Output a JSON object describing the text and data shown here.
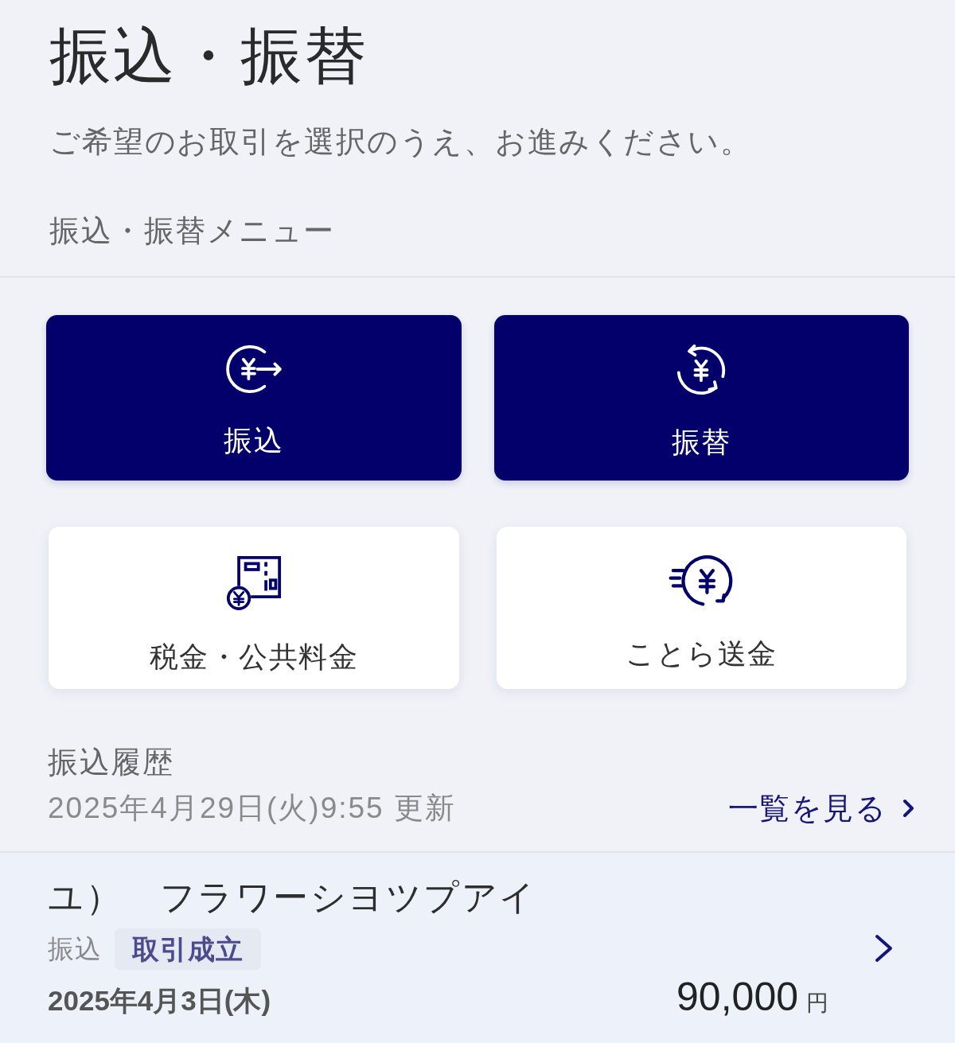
{
  "title": "振込・振替",
  "subtitle": "ご希望のお取引を選択のうえ、お進みください。",
  "menu": {
    "heading": "振込・振替メニュー",
    "items": [
      {
        "label": "振込",
        "kind": "primary"
      },
      {
        "label": "振替",
        "kind": "primary"
      },
      {
        "label": "税金・公共料金",
        "kind": "secondary"
      },
      {
        "label": "ことら送金",
        "kind": "secondary"
      }
    ]
  },
  "history": {
    "heading": "振込履歴",
    "updated": "2025年4月29日(火)9:55 更新",
    "link": "一覧を見る",
    "transactions": [
      {
        "name": "ユ）　フラワーシヨツプアイ",
        "type": "振込",
        "status": "取引成立",
        "date": "2025年4月3日(木)",
        "amount": "90,000",
        "unit": "円"
      }
    ]
  }
}
